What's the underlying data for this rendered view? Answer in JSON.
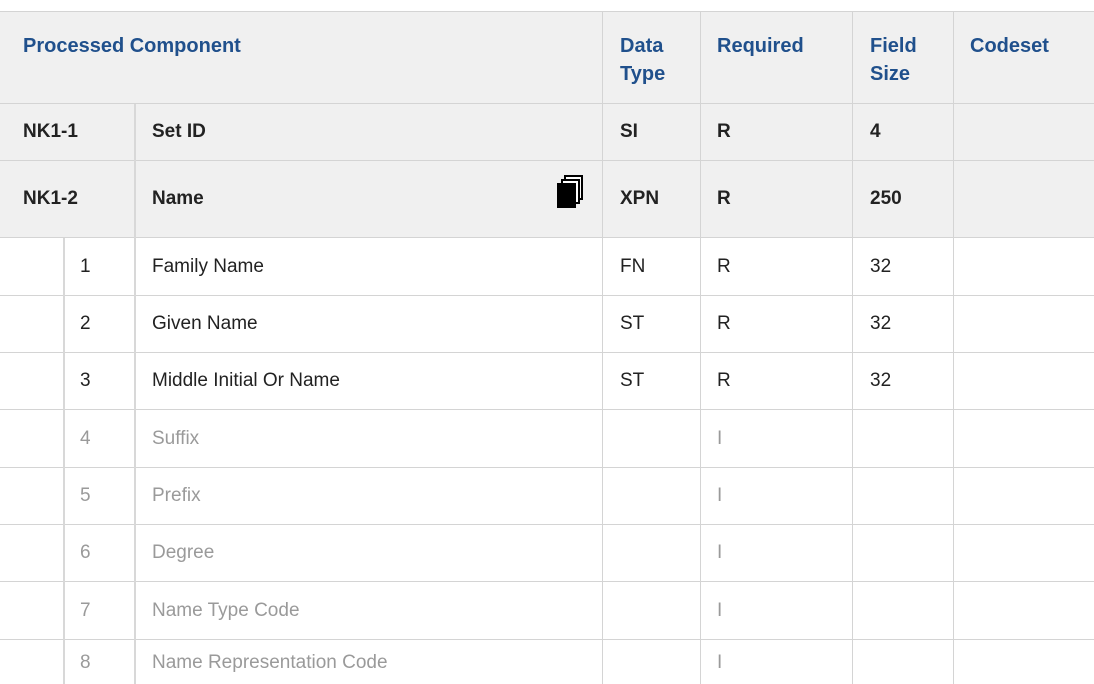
{
  "header": {
    "processed_component": "Processed Component",
    "data_type_line1": "Data",
    "data_type_line2": "Type",
    "required": "Required",
    "field_size_line1": "Field",
    "field_size_line2": "Size",
    "codeset": "Codeset"
  },
  "fields": [
    {
      "id": "NK1-1",
      "name": "Set ID",
      "data_type": "SI",
      "required": "R",
      "field_size": "4",
      "codeset": ""
    },
    {
      "id": "NK1-2",
      "name": "Name",
      "data_type": "XPN",
      "required": "R",
      "field_size": "250",
      "codeset": "",
      "icon": "copy-icon"
    }
  ],
  "components": [
    {
      "num": "1",
      "name": "Family Name",
      "data_type": "FN",
      "required": "R",
      "field_size": "32",
      "codeset": ""
    },
    {
      "num": "2",
      "name": "Given Name",
      "data_type": "ST",
      "required": "R",
      "field_size": "32",
      "codeset": ""
    },
    {
      "num": "3",
      "name": "Middle Initial Or Name",
      "data_type": "ST",
      "required": "R",
      "field_size": "32",
      "codeset": ""
    },
    {
      "num": "4",
      "name": "Suffix",
      "data_type": "",
      "required": "I",
      "field_size": "",
      "codeset": ""
    },
    {
      "num": "5",
      "name": "Prefix",
      "data_type": "",
      "required": "I",
      "field_size": "",
      "codeset": ""
    },
    {
      "num": "6",
      "name": "Degree",
      "data_type": "",
      "required": "I",
      "field_size": "",
      "codeset": ""
    },
    {
      "num": "7",
      "name": "Name Type Code",
      "data_type": "",
      "required": "I",
      "field_size": "",
      "codeset": ""
    },
    {
      "num": "8",
      "name": "Name Representation Code",
      "data_type": "",
      "required": "I",
      "field_size": "",
      "codeset": ""
    }
  ],
  "colors": {
    "header_text": "#20508c",
    "header_bg": "#f0f0f0",
    "border": "#d4d4d4",
    "ignored_text": "#9a9a9a"
  }
}
